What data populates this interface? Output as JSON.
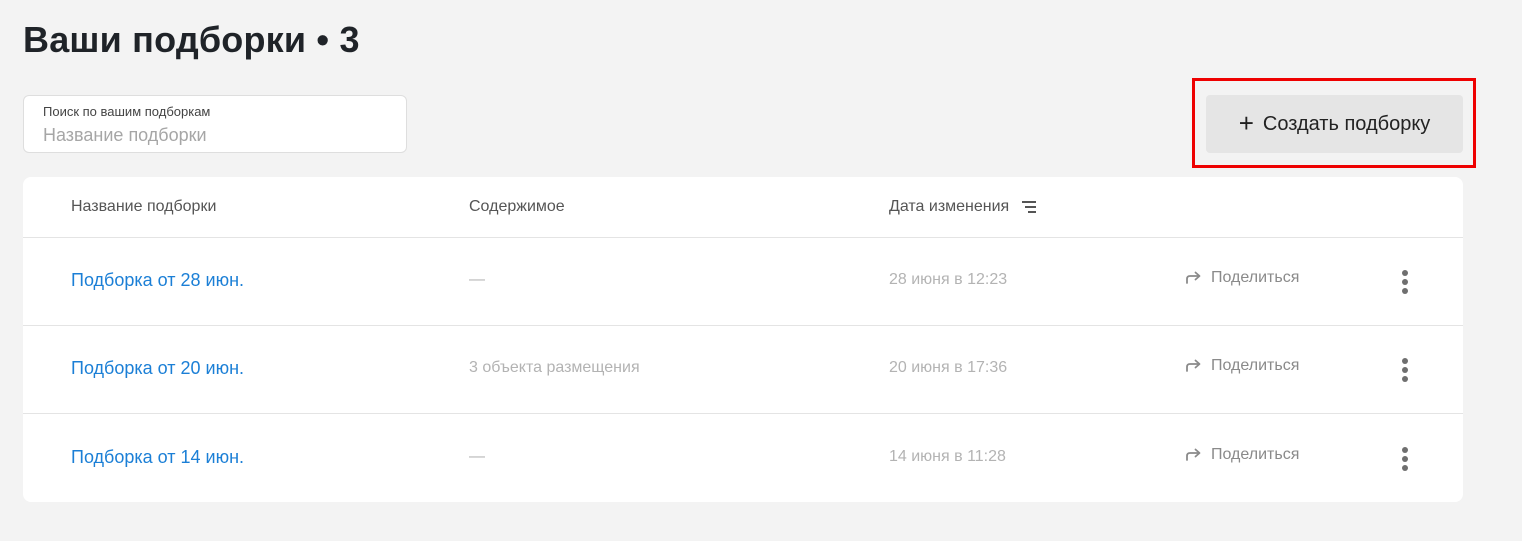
{
  "page": {
    "title": "Ваши подборки • 3"
  },
  "search": {
    "label": "Поиск по вашим подборкам",
    "placeholder": "Название подборки",
    "value": ""
  },
  "toolbar": {
    "create_label": "Создать подборку",
    "create_icon": "plus-icon",
    "highlight_color": "#ee0000"
  },
  "table": {
    "columns": {
      "name": "Название подборки",
      "content": "Содержимое",
      "date": "Дата изменения"
    },
    "sort_icon": "sort-lines-icon",
    "rows": [
      {
        "name": "Подборка от 28 июн.",
        "content": "—",
        "date": "28 июня в 12:23",
        "share_label": "Поделиться"
      },
      {
        "name": "Подборка от 20 июн.",
        "content": "3 объекта размещения",
        "date": "20 июня в 17:36",
        "share_label": "Поделиться"
      },
      {
        "name": "Подборка от 14 июн.",
        "content": "—",
        "date": "14 июня в 11:28",
        "share_label": "Поделиться"
      }
    ]
  },
  "colors": {
    "link": "#1b7fd6",
    "muted": "#b3b3b3",
    "background": "#f3f3f3"
  }
}
